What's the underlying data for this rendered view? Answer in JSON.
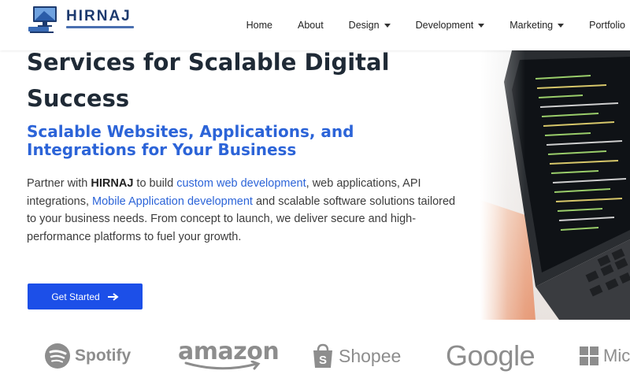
{
  "brand": {
    "name": "HIRNAJ",
    "logo_icon": "monitor-laptop-icon"
  },
  "nav": {
    "items": [
      {
        "label": "Home",
        "dropdown": false
      },
      {
        "label": "About",
        "dropdown": false
      },
      {
        "label": "Design",
        "dropdown": true
      },
      {
        "label": "Development",
        "dropdown": true
      },
      {
        "label": "Marketing",
        "dropdown": true
      },
      {
        "label": "Portfolio",
        "dropdown": false
      }
    ]
  },
  "hero": {
    "title": "Services for Scalable Digital Success",
    "subtitle": "Scalable Websites, Applications, and Integrations for Your Business",
    "body": {
      "p1": "Partner with ",
      "brand": "HIRNAJ",
      "p2": " to build ",
      "link1": "custom web development",
      "p3": ", web applications, API integrations, ",
      "link2": "Mobile Application development",
      "p4": " and scalable software solutions tailored to your business needs. From concept to launch, we deliver secure and high-performance platforms to fuel your growth."
    },
    "cta_label": "Get Started",
    "cta_icon": "arrow-right-icon"
  },
  "brands": {
    "spotify": "Spotify",
    "amazon": "amazon",
    "shopee": "Shopee",
    "google": "Google",
    "microsoft": "Micr"
  },
  "colors": {
    "accent": "#2c64d8",
    "button": "#1c4fe8",
    "heading": "#1f2a36"
  }
}
